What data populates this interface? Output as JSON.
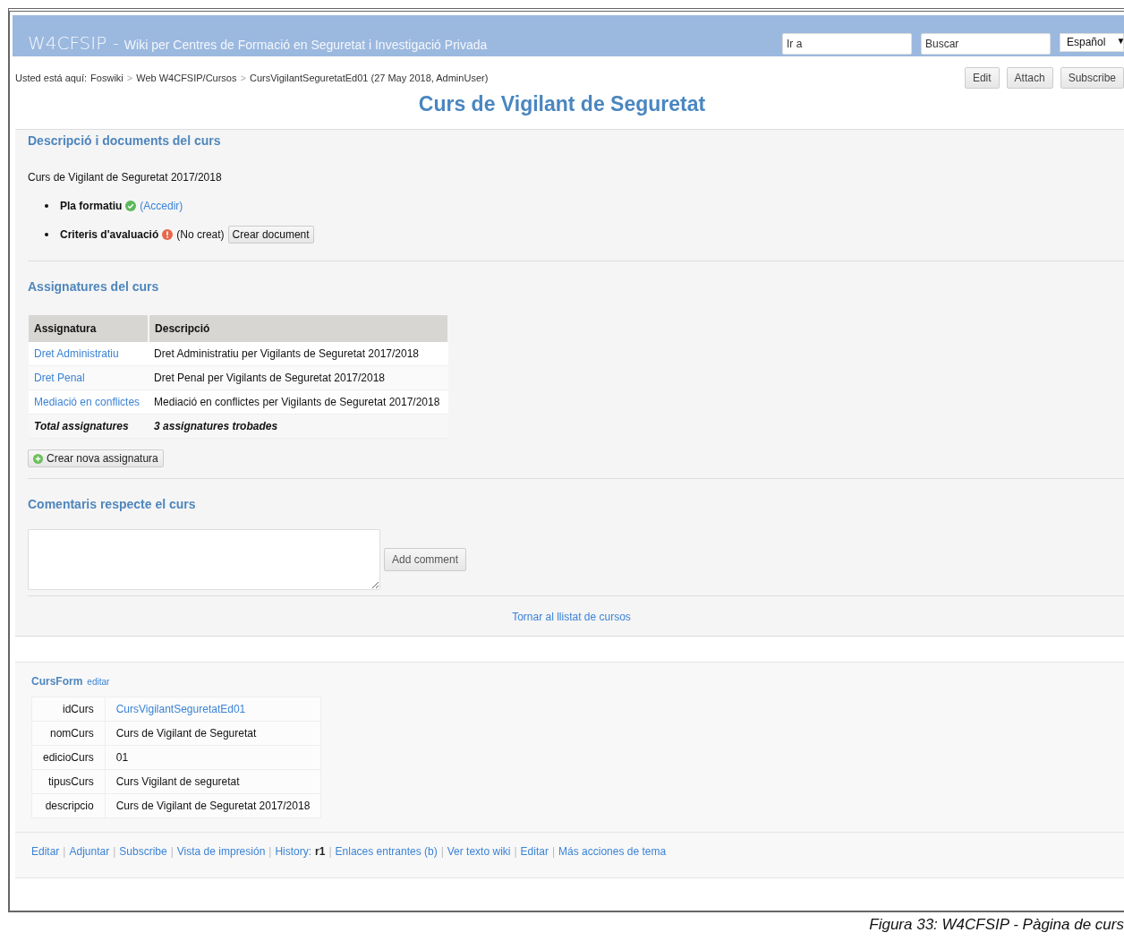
{
  "header": {
    "site": "W4CFSIP -",
    "subtitle": "Wiki per Centres de Formació en Seguretat i Investigació Privada",
    "jump_field": {
      "placeholder": "Ir a"
    },
    "search_field": {
      "placeholder": "Buscar"
    },
    "language": {
      "value": "Español",
      "caret": "▼"
    }
  },
  "breadcrumb": {
    "label": "Usted está aquí:",
    "items": [
      {
        "text": "Foswiki",
        "sep": ">"
      },
      {
        "text": "Web W4CFSIP/Cursos",
        "sep": ">"
      },
      {
        "text": "CursVigilantSeguretatEd01 (27 May 2018, AdminUser)"
      }
    ]
  },
  "actions": [
    "Edit",
    "Attach",
    "Subscribe"
  ],
  "title": "Curs de Vigilant de Seguretat",
  "description": {
    "heading": "Descripció i documents del curs",
    "text": "Curs de Vigilant de Seguretat 2017/2018",
    "documents": [
      {
        "label": "Pla formatiu",
        "kind": "ok",
        "link": "(Accedir)"
      },
      {
        "label": "Criteris d'avaluació",
        "kind": "missing",
        "note": "(No creat)",
        "button": "Crear document"
      }
    ]
  },
  "subjects": {
    "heading": "Assignatures del curs",
    "columns": [
      "Assignatura",
      "Descripció"
    ],
    "rows": [
      {
        "kind": "link",
        "cells": [
          "Dret Administratiu",
          "Dret Administratiu per Vigilants de Seguretat 2017/2018"
        ]
      },
      {
        "kind": "link",
        "cells": [
          "Dret Penal",
          "Dret Penal per Vigilants de Seguretat 2017/2018"
        ]
      },
      {
        "kind": "link",
        "cells": [
          "Mediació en conflictes",
          "Mediació en conflictes per Vigilants de Seguretat 2017/2018"
        ]
      },
      {
        "kind": "total",
        "cells": [
          "Total assignatures",
          "3 assignatures trobades"
        ]
      }
    ],
    "button": "Crear nova assignatura"
  },
  "comments": {
    "heading": "Comentaris respecte el curs",
    "button": "Add comment",
    "back_link": "Tornar al llistat de cursos"
  },
  "form": {
    "name": "CursForm",
    "edit": "editar",
    "fields": [
      {
        "label": "idCurs",
        "value": "CursVigilantSeguretatEd01",
        "kind": "link"
      },
      {
        "label": "nomCurs",
        "value": "Curs de Vigilant de Seguretat",
        "kind": "text"
      },
      {
        "label": "edicioCurs",
        "value": "01",
        "kind": "text"
      },
      {
        "label": "tipusCurs",
        "value": "Curs Vigilant de seguretat",
        "kind": "text"
      },
      {
        "label": "descripcio",
        "value": "Curs de Vigilant de Seguretat 2017/2018",
        "kind": "text"
      }
    ]
  },
  "footer_links": [
    {
      "text": "Editar",
      "sep": "|"
    },
    {
      "text": "Adjuntar",
      "sep": "|"
    },
    {
      "text": "Subscribe",
      "sep": "|"
    },
    {
      "text": "Vista de impresión",
      "sep": "|"
    },
    {
      "text": "History:",
      "extra": "r1",
      "sep": "|"
    },
    {
      "text": "Enlaces entrantes (b)",
      "sep": "|"
    },
    {
      "text": "Ver texto wiki",
      "sep": "|"
    },
    {
      "text": "Editar",
      "sep": "|"
    },
    {
      "text": "Más acciones de tema"
    }
  ],
  "caption": "Figura 33: W4CFSIP - Pàgina de curs"
}
